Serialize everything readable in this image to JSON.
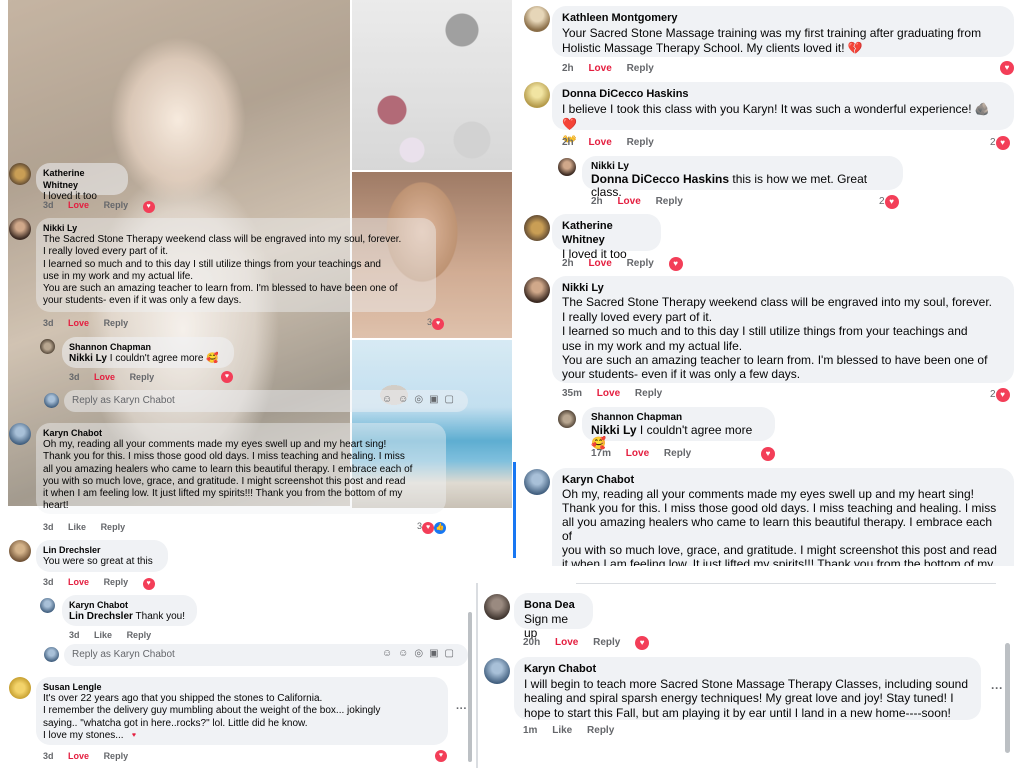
{
  "panel_left": {
    "comments": [
      {
        "name": "Katherine Whitney",
        "text": "I loved it too",
        "time": "3d",
        "love": "Love",
        "reply": "Reply"
      },
      {
        "name": "Nikki Ly",
        "text": "The Sacred Stone Therapy weekend class will be engraved into my soul, forever.\nI really loved every part of it.\nI learned so much and to this day I still utilize things from your teachings and\nuse in my work and my actual life.\nYou are such an amazing teacher to learn from. I'm blessed to have been one of\nyour students- even if it was only a few days.",
        "time": "3d",
        "love": "Love",
        "reply": "Reply",
        "count": "3"
      },
      {
        "name": "Shannon Chapman",
        "mention": "Nikki Ly",
        "text": " I couldn't agree more 🥰",
        "time": "3d",
        "love": "Love",
        "reply": "Reply"
      },
      {
        "name": "Karyn Chabot",
        "text": "Oh my, reading all your comments made my eyes swell up and my heart sing!\nThank you for this. I miss those good old days. I miss teaching and healing. I miss\nall you amazing healers who came to learn this beautiful therapy. I embrace each of\nyou with so much love, grace, and gratitude. I might screenshot this post and read\nit when I am feeling low. It just lifted my spirits!!! Thank you from the bottom of my\nheart!",
        "time": "3d",
        "like": "Like",
        "reply": "Reply",
        "count": "3"
      },
      {
        "name": "Lin Drechsler",
        "text": "You were so great at this",
        "time": "3d",
        "love": "Love",
        "reply": "Reply"
      },
      {
        "name": "Karyn Chabot",
        "mention": "Lin Drechsler",
        "text": " Thank you!",
        "time": "3d",
        "like": "Like",
        "reply": "Reply"
      },
      {
        "name": "Susan Lengle",
        "text": "It's over 22 years ago that you shipped the stones to California.\nI remember the delivery guy mumbling about the weight of the box... jokingly\nsaying.. \"whatcha got in here..rocks?\" lol. Little did he know.\nI love my stones...",
        "time": "3d",
        "love": "Love",
        "reply": "Reply"
      }
    ],
    "reply_placeholder": "Reply as Karyn Chabot"
  },
  "panel_right": {
    "comments": [
      {
        "name": "Kathleen Montgomery",
        "text": "Your Sacred Stone Massage training was my first training after graduating from\nHolistic Massage Therapy School. My clients loved it! 💔",
        "time": "2h",
        "love": "Love",
        "reply": "Reply"
      },
      {
        "name": "Donna DiCecco Haskins",
        "text": "I believe I took this class with you Karyn! It was such a wonderful experience! 🪨❤️\n👐",
        "time": "2h",
        "love": "Love",
        "reply": "Reply",
        "count": "2"
      },
      {
        "name": "Nikki Ly",
        "mention": "Donna DiCecco Haskins",
        "text": " this is how we met. Great class.",
        "time": "2h",
        "love": "Love",
        "reply": "Reply",
        "count": "2"
      },
      {
        "name": "Katherine Whitney",
        "text": "I loved it too",
        "time": "2h",
        "love": "Love",
        "reply": "Reply"
      },
      {
        "name": "Nikki Ly",
        "text": "The Sacred Stone Therapy weekend class will be engraved into my soul, forever.\nI really loved every part of it.\nI learned so much and to this day I still utilize things from your teachings and\nuse in my work and my actual life.\nYou are such an amazing teacher to learn from. I'm blessed to have been one of\nyour students- even if it was only a few days.",
        "time": "35m",
        "love": "Love",
        "reply": "Reply",
        "count": "2"
      },
      {
        "name": "Shannon Chapman",
        "mention": "Nikki Ly",
        "text": " I couldn't agree more 🥰",
        "time": "17m",
        "love": "Love",
        "reply": "Reply"
      },
      {
        "name": "Karyn Chabot",
        "text": "Oh my, reading all your comments made my eyes swell up and my heart sing!\nThank you for this. I miss those good old days. I miss teaching and healing. I miss\nall you amazing healers who came to learn this beautiful therapy. I embrace each of\nyou with so much love, grace, and gratitude. I might screenshot this post and read\nit when I am feeling low. It just lifted my spirits!!! Thank you from the bottom of my"
      }
    ]
  },
  "panel_bottom_right": {
    "comments": [
      {
        "name": "Bona Dea",
        "text": "Sign me up",
        "time": "20h",
        "love": "Love",
        "reply": "Reply"
      },
      {
        "name": "Karyn Chabot",
        "text": "I will begin to teach more Sacred Stone Massage Therapy Classes, including sound\nhealing and spiral sparsh energy techniques! My great love and joy! Stay tuned! I\nhope to start this Fall, but am playing it by ear until I land in a new home----soon!",
        "time": "1m",
        "like": "Like",
        "reply": "Reply"
      }
    ]
  },
  "icons": {
    "heart": "heart-icon",
    "like": "like-icon",
    "more": "more-options-icon"
  },
  "colors": {
    "love_red": "#e41e3f",
    "bubble": "#f0f2f5",
    "meta_gray": "#65676b",
    "like_blue": "#1877f2"
  }
}
